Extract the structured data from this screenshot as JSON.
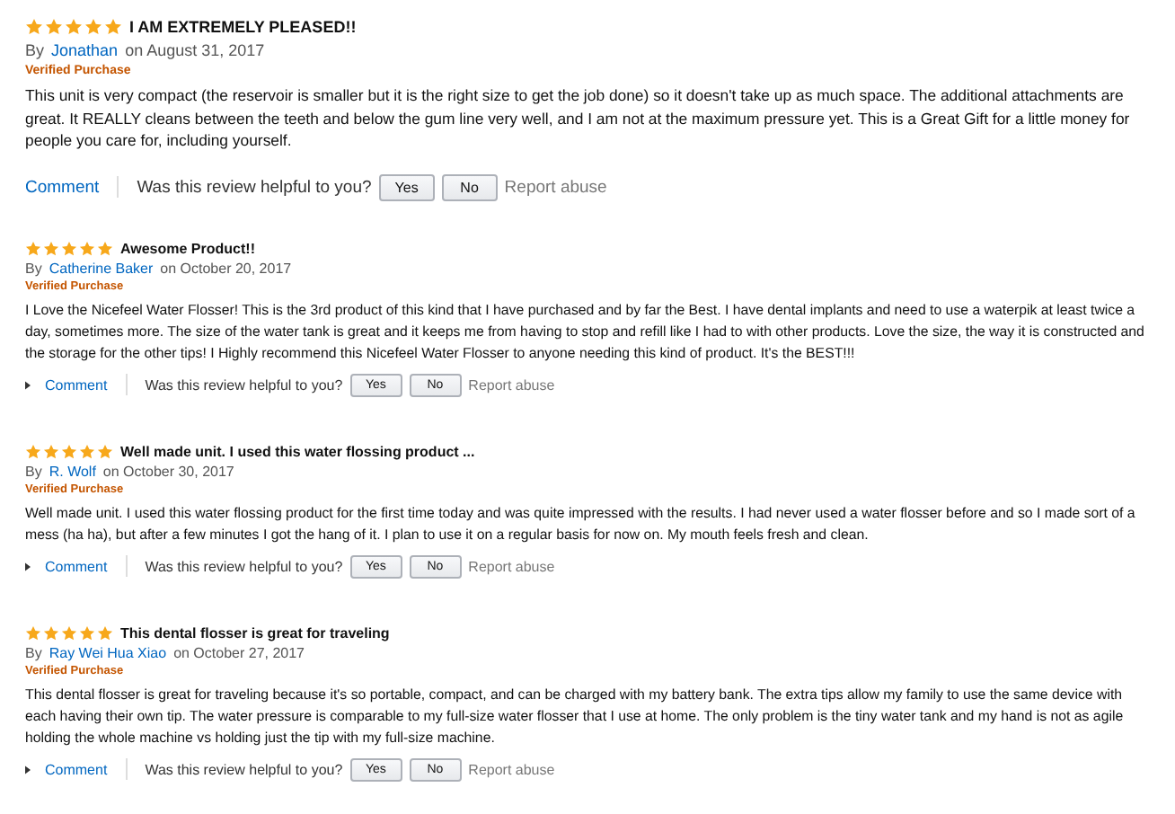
{
  "reviews": [
    {
      "kind": "large",
      "stars": 5,
      "title": "I AM EXTREMELY PLEASED!!",
      "by": "By",
      "author": "Jonathan",
      "date": "on August 31, 2017",
      "badge": "Verified Purchase",
      "body": "This unit is very compact (the reservoir is smaller but it is the right size to get the job done) so it doesn't take up as much space. The additional attachments are great. It REALLY cleans between the teeth and below the gum line very well, and I am not at the maximum pressure yet. This is a Great Gift for a little money for people you care for, including yourself.",
      "comment": "Comment",
      "question": "Was this review helpful to you?",
      "yes": "Yes",
      "no": "No",
      "report": "Report abuse"
    },
    {
      "kind": "compact",
      "stars": 5,
      "title": "Awesome Product!!",
      "by": "By",
      "author": "Catherine Baker",
      "date": "on October 20, 2017",
      "badge": "Verified Purchase",
      "body": "I Love the Nicefeel Water Flosser! This is the 3rd product of this kind that I have purchased and by far the Best. I have dental implants and need to use a waterpik at least twice a day, sometimes more. The size of the water tank is great and it keeps me from having to stop and refill like I had to with other products. Love the size, the way it is constructed and the storage for the other tips! I Highly recommend this Nicefeel Water Flosser to anyone needing this kind of product. It's the BEST!!!",
      "comment": "Comment",
      "question": "Was this review helpful to you?",
      "yes": "Yes",
      "no": "No",
      "report": "Report abuse"
    },
    {
      "kind": "compact",
      "stars": 5,
      "title": "Well made unit. I used this water flossing product ...",
      "by": "By",
      "author": "R. Wolf",
      "date": "on October 30, 2017",
      "badge": "Verified Purchase",
      "body": "Well made unit. I used this water flossing product for the first time today and was quite impressed with the results. I had never used a water flosser before and so I made sort of a mess (ha ha), but after a few minutes I got the hang of it. I plan to use it on a regular basis for now on. My mouth feels fresh and clean.",
      "comment": "Comment",
      "question": "Was this review helpful to you?",
      "yes": "Yes",
      "no": "No",
      "report": "Report abuse"
    },
    {
      "kind": "compact",
      "stars": 5,
      "title": "This dental flosser is great for traveling",
      "by": "By",
      "author": "Ray Wei Hua Xiao",
      "date": "on October 27, 2017",
      "badge": "Verified Purchase",
      "body": "This dental flosser is great for traveling because it's so portable, compact, and can be charged with my battery bank. The extra tips allow my family to use the same device with each having their own tip. The water pressure is comparable to my full-size water flosser that I use at home. The only problem is the tiny water tank and my hand is not as agile holding the whole machine vs holding just the tip with my full-size machine.",
      "comment": "Comment",
      "question": "Was this review helpful to you?",
      "yes": "Yes",
      "no": "No",
      "report": "Report abuse"
    }
  ]
}
